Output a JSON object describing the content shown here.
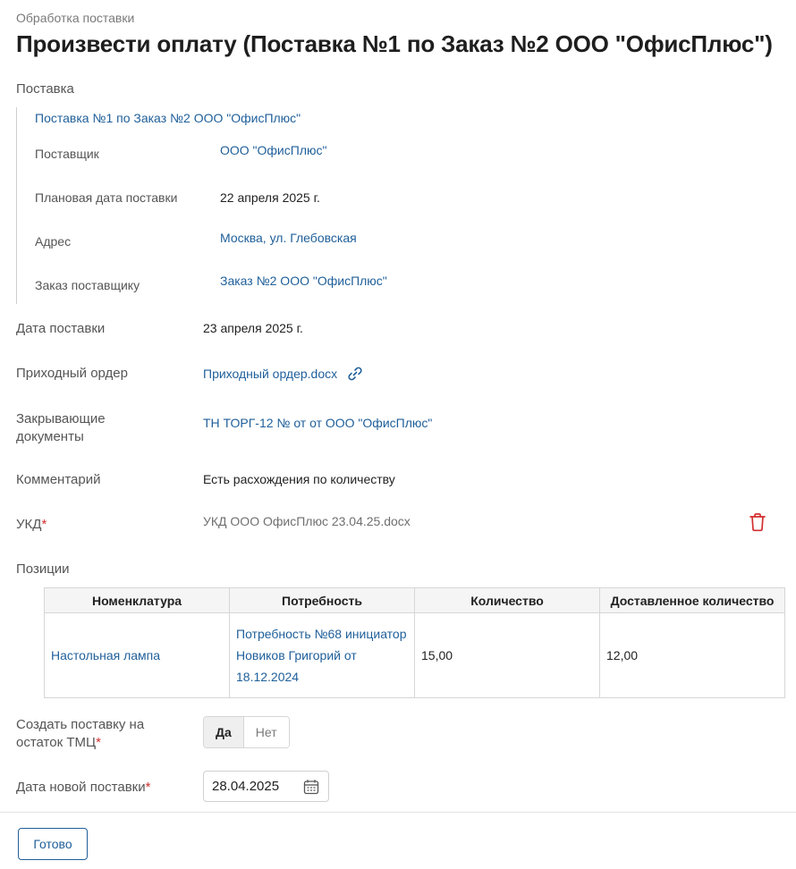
{
  "header": {
    "subtitle": "Обработка поставки",
    "title": "Произвести оплату (Поставка №1 по Заказ №2 ООО \"ОфисПлюс\")"
  },
  "delivery_section": {
    "label": "Поставка",
    "link": "Поставка №1 по Заказ №2 ООО \"ОфисПлюс\"",
    "fields": [
      {
        "label": "Поставщик",
        "value": "ООО \"ОфисПлюс\""
      },
      {
        "label": "Плановая дата поставки",
        "value": "22 апреля 2025 г."
      },
      {
        "label": "Адрес",
        "value": "Москва, ул. Глебовская"
      },
      {
        "label": "Заказ поставщику",
        "value": "Заказ №2 ООО \"ОфисПлюс\""
      }
    ]
  },
  "fields": {
    "delivery_date": {
      "label": "Дата поставки",
      "value": "23 апреля 2025 г."
    },
    "receipt_order": {
      "label": "Приходный ордер",
      "value": "Приходный ордер.docx"
    },
    "closing_docs": {
      "label": "Закрывающие документы",
      "value": "ТН ТОРГ-12 № от от ООО \"ОфисПлюс\""
    },
    "comment": {
      "label": "Комментарий",
      "value": "Есть расхождения по количеству"
    },
    "ukd": {
      "label": "УКД",
      "required_mark": "*",
      "value": "УКД ООО ОфисПлюс 23.04.25.docx"
    }
  },
  "positions": {
    "label": "Позиции",
    "columns": [
      "Номенклатура",
      "Потребность",
      "Количество",
      "Доставленное количество"
    ],
    "rows": [
      {
        "item": "Настольная лампа",
        "need": "Потребность №68 инициатор Новиков Григорий от 18.12.2024",
        "qty": "15,00",
        "delivered": "12,00"
      }
    ]
  },
  "create_remainder": {
    "label": "Создать поставку на остаток ТМЦ",
    "required_mark": "*",
    "options": [
      "Да",
      "Нет"
    ],
    "selected": "Да"
  },
  "new_delivery_date": {
    "label": "Дата новой поставки",
    "required_mark": "*",
    "value": "28.04.2025"
  },
  "footer": {
    "done_label": "Готово"
  },
  "colors": {
    "link": "#1f5f9a",
    "required": "#d32f2f",
    "delete_icon": "#d32f2f"
  },
  "icons": {
    "receipt_order": "paperclip-icon",
    "ukd_delete": "trash-icon",
    "date": "calendar-icon"
  }
}
